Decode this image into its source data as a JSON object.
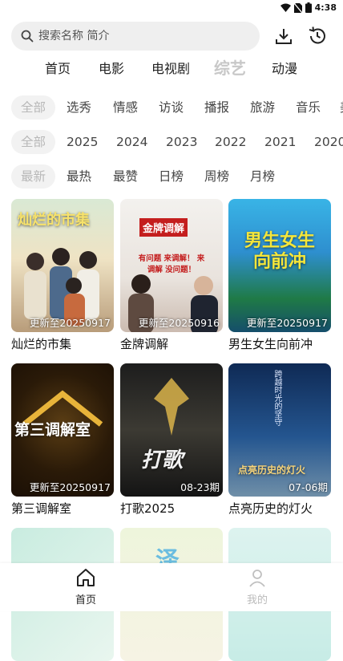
{
  "status": {
    "time": "4:38"
  },
  "search": {
    "placeholder": "搜索名称 简介"
  },
  "tabs": [
    {
      "label": "首页"
    },
    {
      "label": "电影"
    },
    {
      "label": "电视剧"
    },
    {
      "label": "综艺"
    },
    {
      "label": "动漫"
    }
  ],
  "filters": {
    "genres": [
      "全部",
      "选秀",
      "情感",
      "访谈",
      "播报",
      "旅游",
      "音乐",
      "美"
    ],
    "years": [
      "全部",
      "2025",
      "2024",
      "2023",
      "2022",
      "2021",
      "2020"
    ],
    "sort": [
      "最新",
      "最热",
      "最赞",
      "日榜",
      "周榜",
      "月榜"
    ]
  },
  "cards": [
    {
      "title": "灿烂的市集",
      "badge": "更新至20250917",
      "poster_text": "灿烂的市集"
    },
    {
      "title": "金牌调解",
      "badge": "更新至20250916",
      "poster_text": "金牌调解",
      "poster_sub": "有问题 来调解！ 来调解 没问题！"
    },
    {
      "title": "男生女生向前冲",
      "badge": "更新至20250917",
      "poster_text": "男生女生向前冲"
    },
    {
      "title": "第三调解室",
      "badge": "更新至20250917",
      "poster_text": "第三调解室"
    },
    {
      "title": "打歌2025",
      "badge": "08-23期",
      "poster_text": "打歌"
    },
    {
      "title": "点亮历史的灯火",
      "badge": "07-06期",
      "poster_text": "点亮历史的灯火",
      "poster_sub": "跨越时光的坚守"
    },
    {
      "title": "",
      "badge": "",
      "poster_text": ""
    },
    {
      "title": "",
      "badge": "",
      "poster_text": "泽"
    },
    {
      "title": "",
      "badge": "",
      "poster_text": ""
    }
  ],
  "nav": {
    "home": "首页",
    "mine": "我的"
  },
  "colors": {
    "accent": "#222222",
    "muted": "#b8b8b8"
  }
}
